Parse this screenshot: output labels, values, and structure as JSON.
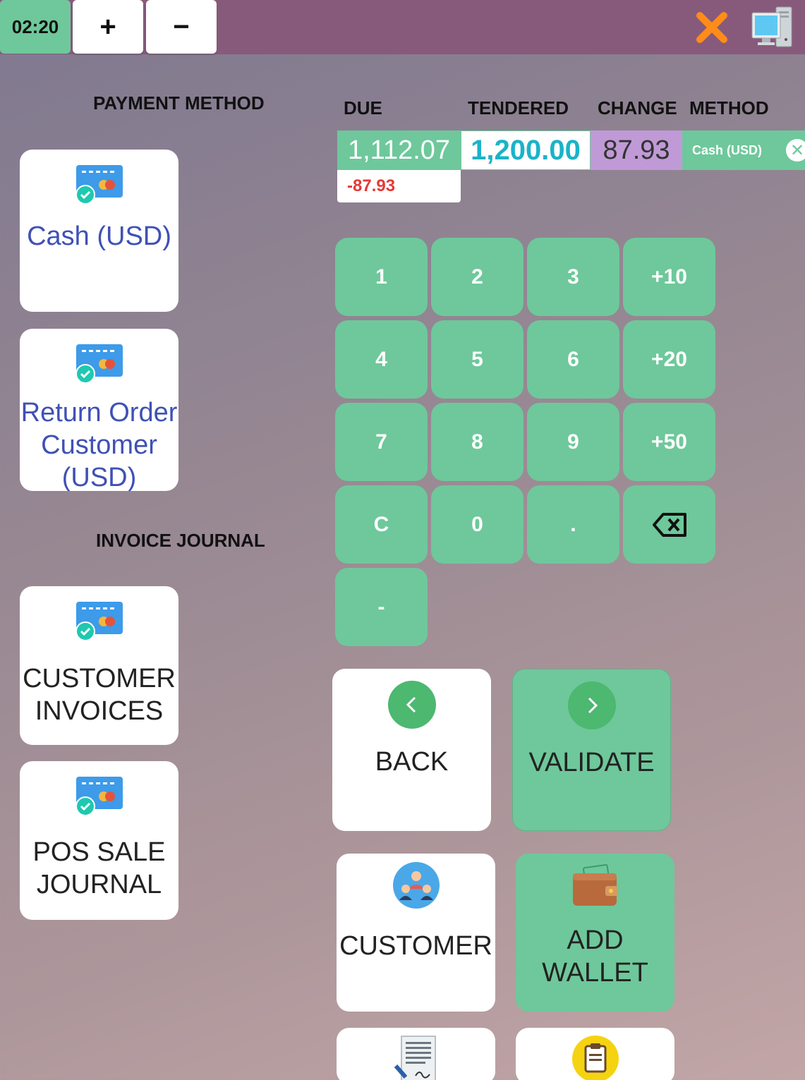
{
  "topbar": {
    "timer": "02:20",
    "zoom_in": "+",
    "zoom_out": "−"
  },
  "payment_method": {
    "title": "PAYMENT METHOD",
    "methods": [
      {
        "label": "Cash (USD)"
      },
      {
        "label": "Return Order Customer (USD)"
      }
    ]
  },
  "invoice_journal": {
    "title": "INVOICE JOURNAL",
    "journals": [
      {
        "label": "CUSTOMER INVOICES"
      },
      {
        "label": "POS SALE JOURNAL"
      }
    ]
  },
  "payment_lines": {
    "headers": {
      "due": "DUE",
      "tendered": "TENDERED",
      "change": "CHANGE",
      "method": "METHOD"
    },
    "line": {
      "due": "1,112.07",
      "remaining": "-87.93",
      "tendered": "1,200.00",
      "change": "87.93",
      "method": "Cash (USD)"
    }
  },
  "numpad": {
    "keys": [
      "1",
      "2",
      "3",
      "+10",
      "4",
      "5",
      "6",
      "+20",
      "7",
      "8",
      "9",
      "+50",
      "C",
      "0",
      ".",
      "⌫",
      "-"
    ]
  },
  "actions": {
    "back": "BACK",
    "validate": "VALIDATE",
    "customer": "CUSTOMER",
    "add_wallet": "ADD WALLET"
  },
  "colors": {
    "topbar": "#875a7b",
    "accent_green": "#6ec89b",
    "tendered_text": "#1ab3c9",
    "change_bg": "#c09ad6",
    "negative_red": "#e53935",
    "method_label_blue": "#3f51b5"
  }
}
